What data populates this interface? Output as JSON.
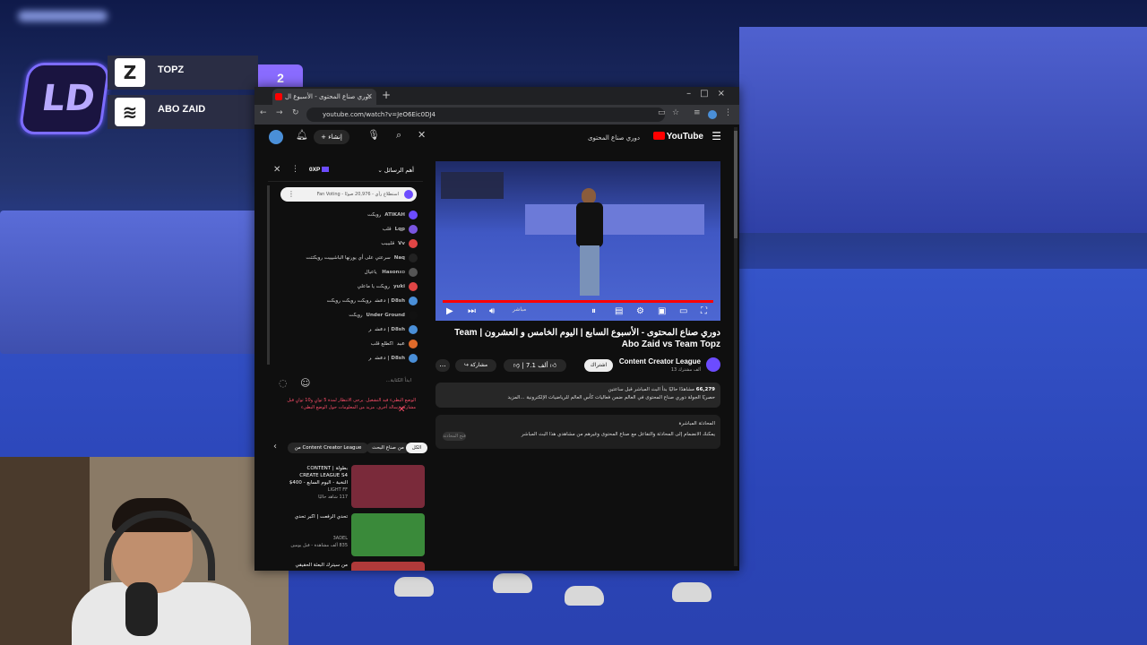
{
  "overlay": {
    "team1": "TOPZ",
    "team2": "ABO ZAID",
    "badge": "2"
  },
  "browser": {
    "tab_title": "دوري صناع المحتوى - الأسبوع ال",
    "url": "youtube.com/watch?v=JeO6Eic0DJ4"
  },
  "youtube": {
    "logo": "YouTube",
    "search_value": "دوري صناع المحتوى",
    "create_label": "إنشاء",
    "video_title": "دوري صناع المحتوى - الأسبوع السابع | اليوم الخامس و العشرون | Team Abo Zaid vs Team Topz",
    "channel_name": "Content Creator League",
    "channel_subs": "13 ألف مشترك",
    "subscribe_label": "اشتراك",
    "likes": "7.1 ألف",
    "share_label": "مشاركة",
    "more_label": "...",
    "desc_views": "66,279",
    "desc_line1": "مشاهدًا حاليًا بدأ البث المباشر قبل ساعتين",
    "desc_line2": "حصريًا الجولة دوري صناع المحتوى في العالم ضمن فعاليات كأس العالم للرياضيات الإلكترونية ...المزيد",
    "live_chat_title": "المحادثة المباشرة",
    "live_chat_text": "يمكنك الانضمام إلى المحادثة والتفاعل مع صناع المحتوى وغيرهم من مشاهدي هذا البث المباشر",
    "live_chat_chip": "فتح المحادثة",
    "live_badge": "مباشر"
  },
  "chat": {
    "top_label": "أهم الرسائل",
    "xp_label": "0XP",
    "pinned": "Fan Voting - استطلاع رأي - 20,976 صوتًا",
    "messages": [
      {
        "name": "ATIKAH",
        "text": "رويكت",
        "color": "#6c4cff"
      },
      {
        "name": "Lqp",
        "text": "قلب",
        "color": "#7a55e0"
      },
      {
        "name": "Vv",
        "text": "قلبببب",
        "color": "#e04545"
      },
      {
        "name": "Naq",
        "text": "سرعتي على أي يورنها الباشيييت رويكتتت",
        "color": "#222222"
      },
      {
        "name": "Hason",
        "text": "xo ياعيال",
        "color": "#555555"
      },
      {
        "name": "yuki",
        "text": "رويكت يا ماعلي",
        "color": "#e04545"
      },
      {
        "name": "D8sh | دعش",
        "text": "رويكت رويكت رويكت",
        "color": "#4a8fd8"
      },
      {
        "name": "Under Ground",
        "text": "رويكت",
        "color": "#111111"
      },
      {
        "name": "D8sh | دعش",
        "text": "ر",
        "color": "#4a8fd8"
      },
      {
        "name": "عيد",
        "text": "اكطلع قلب",
        "color": "#e06a2a"
      },
      {
        "name": "D8sh | دعش",
        "text": "ر",
        "color": "#4a8fd8"
      }
    ],
    "input_placeholder": "ابدأ الكتابة...",
    "warning": "الوضع البطيء قيد التشغيل. يرجى الانتظار لمدة 5 ثوانٍ و10 ثوانٍ قبل مشاركة رسالة أخرى. مزيد من المعلومات حول الوضع البطيء"
  },
  "recommended": {
    "chips": [
      "الكل",
      "من صناع البحث",
      "من Content Creator League"
    ],
    "items": [
      {
        "title": "بطولة | CONTENT CREATE LEAGUE S4 النخبة - اليوم السابع - 400$",
        "sub": "LIGHT FF",
        "meta": "117 شاهد حاليًا",
        "thumb_color": "#7a2a3a"
      },
      {
        "title": "تحدي الرفعت | اكبر تحدي",
        "sub": "3ADEL",
        "meta": "835 ألف مشاهدة - قبل يومين",
        "thumb_color": "#3a8a3a"
      },
      {
        "title": "من سيترك البعثة الحقيقي",
        "sub": "",
        "meta": "",
        "thumb_color": "#b03a3a"
      }
    ]
  }
}
